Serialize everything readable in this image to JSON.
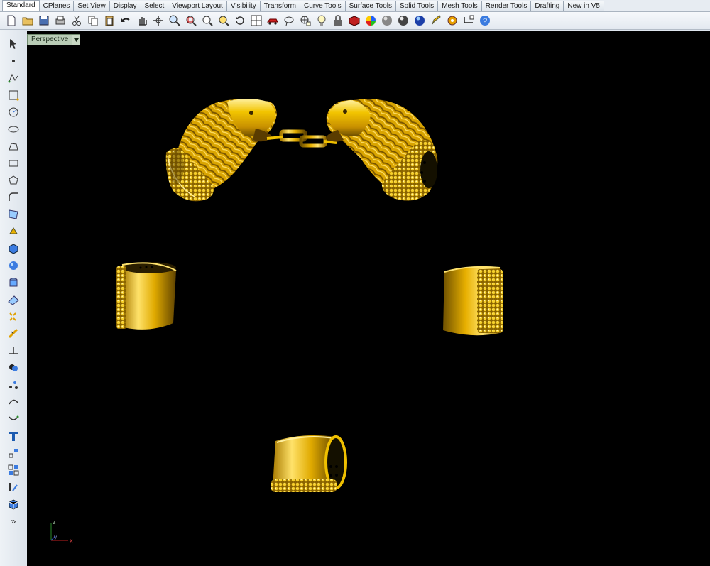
{
  "tabs": [
    {
      "label": "Standard",
      "active": true
    },
    {
      "label": "CPlanes"
    },
    {
      "label": "Set View"
    },
    {
      "label": "Display"
    },
    {
      "label": "Select"
    },
    {
      "label": "Viewport Layout"
    },
    {
      "label": "Visibility"
    },
    {
      "label": "Transform"
    },
    {
      "label": "Curve Tools"
    },
    {
      "label": "Surface Tools"
    },
    {
      "label": "Solid Tools"
    },
    {
      "label": "Mesh Tools"
    },
    {
      "label": "Render Tools"
    },
    {
      "label": "Drafting"
    },
    {
      "label": "New in V5"
    }
  ],
  "toolbar_icons": [
    "new-icon",
    "open-icon",
    "save-icon",
    "print-icon",
    "cut-icon",
    "copy-icon",
    "paste-icon",
    "undo-icon",
    "pan-hand-icon",
    "move-view-icon",
    "zoom-icon",
    "zoom-window-icon",
    "zoom-extents-icon",
    "zoom-selected-icon",
    "rotate-view-icon",
    "four-viewports-icon",
    "car-render-icon",
    "lasso-icon",
    "grid-snap-icon",
    "light-bulb-icon",
    "lock-icon",
    "render-shade-icon",
    "color-wheel-icon",
    "sphere-gray-icon",
    "sphere-silver-icon",
    "sphere-blue-icon",
    "pencil-options-icon",
    "gear-settings-icon",
    "dimension-icon",
    "help-icon"
  ],
  "sidebar_icons": [
    "select-arrow-icon",
    "point-icon",
    "polyline-icon",
    "curve-control-icon",
    "circle-icon",
    "ellipse-icon",
    "polygon-curve-icon",
    "rectangle-icon",
    "polygon-icon",
    "fillet-curve-icon",
    "surface-points-icon",
    "surface-extrude-icon",
    "box-solid-icon",
    "sphere-solid-icon",
    "cylinder-solid-icon",
    "mesh-plane-icon",
    "explode-icon",
    "trim-icon",
    "split-icon",
    "boolean-icon",
    "points-cluster-icon",
    "curve-offset-icon",
    "curve-flow-icon",
    "text-icon",
    "transform-icon",
    "array-icon",
    "dimension-bar-icon",
    "cube-icon",
    "more-icon"
  ],
  "viewport": {
    "label": "Perspective",
    "axis": {
      "z": "z",
      "y": "y",
      "x": "x"
    }
  },
  "colors": {
    "gold": "#e8b800",
    "gold_dark": "#7a5a00",
    "viewport_bg": "#000000"
  }
}
